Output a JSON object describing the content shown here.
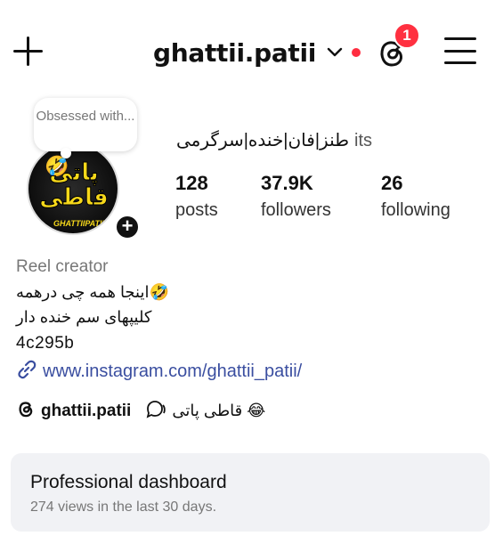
{
  "header": {
    "username": "ghattii.patii",
    "notification_count": "1"
  },
  "profile": {
    "note": "Obsessed with...",
    "avatar_logo_text": "پاتی قاطی",
    "avatar_logo_sub": "GHATTIIPATII",
    "fullname_rtl": "طنز|فان|خنده|سرگرمی",
    "fullname_prefix": "its",
    "stats": [
      {
        "value": "128",
        "label": "posts"
      },
      {
        "value": "37.9K",
        "label": "followers"
      },
      {
        "value": "26",
        "label": "following"
      }
    ],
    "category": "Reel creator",
    "bio_line1": "🤣اینجا همه چی درهمه",
    "bio_line2": "کلیپهای سم خنده دار",
    "bio_line3": "4c295b",
    "link": "www.instagram.com/ghattii_patii/",
    "threads_handle": "ghattii.patii",
    "channel_name": "😂 قاطی پاتی"
  },
  "dashboard": {
    "title": "Professional dashboard",
    "subtitle": "274 views in the last 30 days."
  },
  "icons": [
    "plus-icon",
    "chevron-down-icon",
    "threads-icon",
    "hamburger-menu-icon",
    "add-story-icon",
    "link-icon",
    "broadcast-chat-icon"
  ],
  "colors": {
    "accent_red": "#ff3040",
    "link_blue": "#3a4ea0",
    "card_bg": "#f1f2f5"
  }
}
